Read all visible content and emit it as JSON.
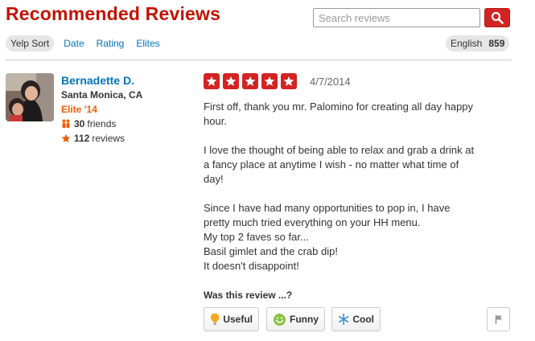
{
  "header": {
    "title": "Recommended Reviews",
    "search_placeholder": "Search reviews"
  },
  "sort": {
    "items": [
      "Yelp Sort",
      "Date",
      "Rating",
      "Elites"
    ],
    "active": "Yelp Sort"
  },
  "language": {
    "label": "English",
    "count": "859"
  },
  "review": {
    "user": {
      "name": "Bernadette D.",
      "location": "Santa Monica, CA",
      "elite": "Elite '14",
      "friends_count": "30",
      "friends_label": "friends",
      "reviews_count": "112",
      "reviews_label": "reviews"
    },
    "rating": 5,
    "date": "4/7/2014",
    "paragraphs": [
      [
        "First off, thank you mr. Palomino for creating all day happy",
        "hour."
      ],
      [
        "I love the thought of being able to relax and grab a drink at",
        "a fancy place at anytime I wish - no matter what time of",
        "day!"
      ],
      [
        "Since I have had many opportunities to pop in, I have",
        "pretty much tried everything on your HH menu.",
        "My top 2 faves so far...",
        "Basil gimlet and the crab dip!",
        "It doesn't disappoint!"
      ]
    ],
    "feedback_prompt": "Was this review ...?",
    "votes": {
      "useful": "Useful",
      "funny": "Funny",
      "cool": "Cool"
    }
  },
  "colors": {
    "brand_red": "#d32323",
    "link_blue": "#0073bb",
    "elite_orange": "#f15c00"
  },
  "icons": [
    "search-icon",
    "star-icon",
    "friends-icon",
    "review-star-icon",
    "lightbulb-icon",
    "smiley-icon",
    "snowflake-icon",
    "flag-icon"
  ]
}
